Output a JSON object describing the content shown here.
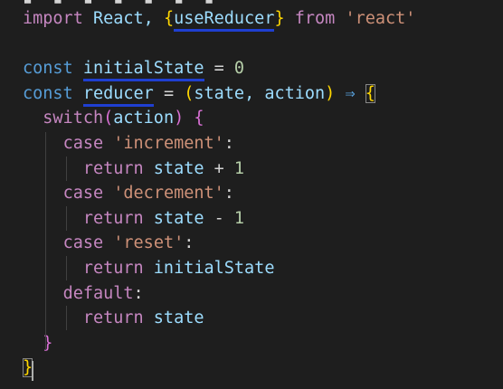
{
  "editor": {
    "lines": [
      {
        "tokens": [
          {
            "t": "import",
            "c": "kw-purple"
          },
          {
            "t": " React, ",
            "c": "ident"
          },
          {
            "t": "{",
            "c": "bracket-yellow"
          },
          {
            "t": "useReducer",
            "c": "ident",
            "underline": true
          },
          {
            "t": "}",
            "c": "bracket-yellow"
          },
          {
            "t": " from ",
            "c": "kw-purple"
          },
          {
            "t": "'react'",
            "c": "str"
          }
        ]
      },
      {
        "tokens": []
      },
      {
        "tokens": [
          {
            "t": "const",
            "c": "kw-blue"
          },
          {
            "t": " ",
            "c": "plain"
          },
          {
            "t": "initialState",
            "c": "var",
            "underline": true
          },
          {
            "t": " = ",
            "c": "plain"
          },
          {
            "t": "0",
            "c": "num"
          }
        ]
      },
      {
        "tokens": [
          {
            "t": "const",
            "c": "kw-blue"
          },
          {
            "t": " ",
            "c": "plain"
          },
          {
            "t": "reducer",
            "c": "var",
            "underline": true
          },
          {
            "t": " = ",
            "c": "plain"
          },
          {
            "t": "(",
            "c": "bracket-yellow"
          },
          {
            "t": "state, action",
            "c": "var"
          },
          {
            "t": ")",
            "c": "bracket-yellow"
          },
          {
            "t": " ⇒ ",
            "c": "kw-blue"
          },
          {
            "t": "{",
            "c": "bracket-yellow",
            "box": true
          }
        ]
      },
      {
        "tokens": [
          {
            "t": "  ",
            "c": "plain"
          },
          {
            "t": "switch",
            "c": "kw-purple"
          },
          {
            "t": "(",
            "c": "bracket-purple"
          },
          {
            "t": "action",
            "c": "var"
          },
          {
            "t": ")",
            "c": "bracket-purple"
          },
          {
            "t": " ",
            "c": "plain"
          },
          {
            "t": "{",
            "c": "bracket-purple"
          }
        ]
      },
      {
        "tokens": [
          {
            "t": "    ",
            "c": "plain"
          },
          {
            "t": "case",
            "c": "kw-purple"
          },
          {
            "t": " ",
            "c": "plain"
          },
          {
            "t": "'increment'",
            "c": "str"
          },
          {
            "t": ":",
            "c": "plain"
          }
        ]
      },
      {
        "tokens": [
          {
            "t": "      ",
            "c": "plain"
          },
          {
            "t": "return",
            "c": "kw-purple"
          },
          {
            "t": " ",
            "c": "plain"
          },
          {
            "t": "state",
            "c": "var"
          },
          {
            "t": " + ",
            "c": "plain"
          },
          {
            "t": "1",
            "c": "num"
          }
        ]
      },
      {
        "tokens": [
          {
            "t": "    ",
            "c": "plain"
          },
          {
            "t": "case",
            "c": "kw-purple"
          },
          {
            "t": " ",
            "c": "plain"
          },
          {
            "t": "'decrement'",
            "c": "str"
          },
          {
            "t": ":",
            "c": "plain"
          }
        ]
      },
      {
        "tokens": [
          {
            "t": "      ",
            "c": "plain"
          },
          {
            "t": "return",
            "c": "kw-purple"
          },
          {
            "t": " ",
            "c": "plain"
          },
          {
            "t": "state",
            "c": "var"
          },
          {
            "t": " - ",
            "c": "plain"
          },
          {
            "t": "1",
            "c": "num"
          }
        ]
      },
      {
        "tokens": [
          {
            "t": "    ",
            "c": "plain"
          },
          {
            "t": "case",
            "c": "kw-purple"
          },
          {
            "t": " ",
            "c": "plain"
          },
          {
            "t": "'reset'",
            "c": "str"
          },
          {
            "t": ":",
            "c": "plain"
          }
        ]
      },
      {
        "tokens": [
          {
            "t": "      ",
            "c": "plain"
          },
          {
            "t": "return",
            "c": "kw-purple"
          },
          {
            "t": " ",
            "c": "plain"
          },
          {
            "t": "initialState",
            "c": "var"
          }
        ]
      },
      {
        "tokens": [
          {
            "t": "    ",
            "c": "plain"
          },
          {
            "t": "default",
            "c": "kw-purple"
          },
          {
            "t": ":",
            "c": "plain"
          }
        ]
      },
      {
        "tokens": [
          {
            "t": "      ",
            "c": "plain"
          },
          {
            "t": "return",
            "c": "kw-purple"
          },
          {
            "t": " ",
            "c": "plain"
          },
          {
            "t": "state",
            "c": "var"
          }
        ]
      },
      {
        "tokens": [
          {
            "t": "  ",
            "c": "plain"
          },
          {
            "t": "}",
            "c": "bracket-purple"
          }
        ]
      },
      {
        "tokens": [
          {
            "t": "}",
            "c": "bracket-yellow",
            "box": true
          }
        ]
      }
    ]
  },
  "colors": {
    "background": "#1e1e1e",
    "underline": "#1f3fd1",
    "indent_guide": "#404040"
  }
}
